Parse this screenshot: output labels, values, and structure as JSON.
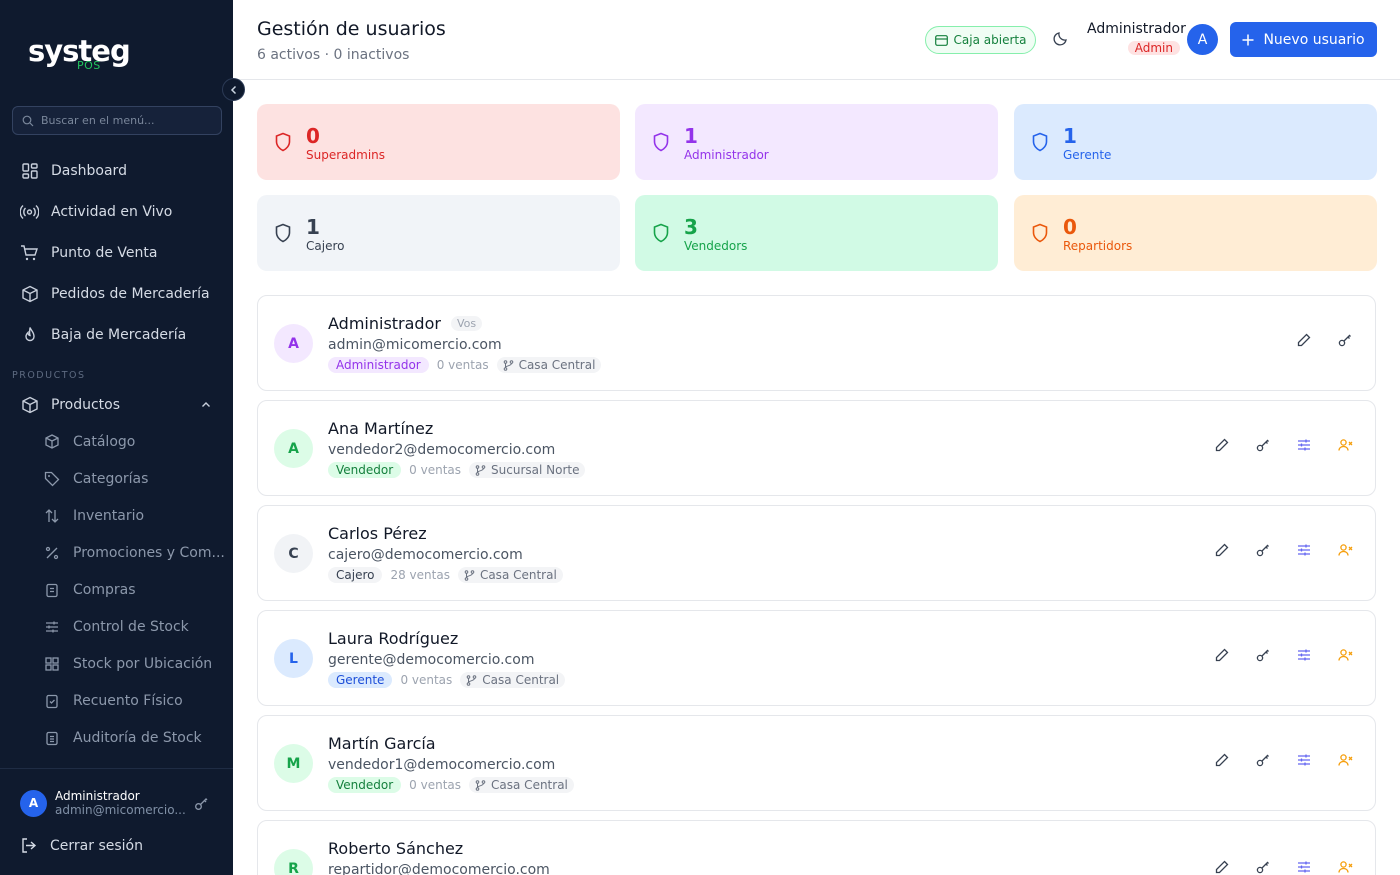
{
  "sidebar": {
    "logo": "systeg",
    "logo_sub": "POS",
    "search_placeholder": "Buscar en el menú...",
    "items": [
      {
        "label": "Dashboard"
      },
      {
        "label": "Actividad en Vivo"
      },
      {
        "label": "Punto de Venta"
      },
      {
        "label": "Pedidos de Mercadería"
      },
      {
        "label": "Baja de Mercadería"
      }
    ],
    "section_label": "PRODUCTOS",
    "group_label": "Productos",
    "subitems": [
      {
        "label": "Catálogo"
      },
      {
        "label": "Categorías"
      },
      {
        "label": "Inventario"
      },
      {
        "label": "Promociones y Com..."
      },
      {
        "label": "Compras"
      },
      {
        "label": "Control de Stock"
      },
      {
        "label": "Stock por Ubicación"
      },
      {
        "label": "Recuento Físico"
      },
      {
        "label": "Auditoría de Stock"
      }
    ],
    "user": {
      "initial": "A",
      "name": "Administrador",
      "email": "admin@micomercio..."
    },
    "logout_label": "Cerrar sesión"
  },
  "header": {
    "title": "Gestión de usuarios",
    "subtitle": "6 activos · 0 inactivos",
    "caja_label": "Caja abierta",
    "user_name": "Administrador",
    "user_role": "Admin",
    "user_initial": "A",
    "new_user_label": "Nuevo usuario"
  },
  "stats": [
    {
      "value": "0",
      "label": "Superadmins",
      "color": "#dc2626",
      "bg": "#fde2e1"
    },
    {
      "value": "1",
      "label": "Administrador",
      "color": "#9333ea",
      "bg": "#f3e8ff"
    },
    {
      "value": "1",
      "label": "Gerente",
      "color": "#2563eb",
      "bg": "#dbeafe"
    },
    {
      "value": "1",
      "label": "Cajero",
      "color": "#374151",
      "bg": "#f1f4f8"
    },
    {
      "value": "3",
      "label": "Vendedors",
      "color": "#16a34a",
      "bg": "#d1fae5"
    },
    {
      "value": "0",
      "label": "Repartidors",
      "color": "#ea580c",
      "bg": "#ffedd5"
    }
  ],
  "users": [
    {
      "initial": "A",
      "name": "Administrador",
      "you": "Vos",
      "email": "admin@micomercio.com",
      "role": "Administrador",
      "sales": "0 ventas",
      "branch": "Casa Central",
      "av_bg": "#f3e8ff",
      "av_fg": "#9333ea",
      "role_bg": "#f3e8ff",
      "role_fg": "#9333ea"
    },
    {
      "initial": "A",
      "name": "Ana Martínez",
      "email": "vendedor2@democomercio.com",
      "role": "Vendedor",
      "sales": "0 ventas",
      "branch": "Sucursal Norte",
      "av_bg": "#dcfce7",
      "av_fg": "#16a34a",
      "role_bg": "#dcfce7",
      "role_fg": "#15803d"
    },
    {
      "initial": "C",
      "name": "Carlos Pérez",
      "email": "cajero@democomercio.com",
      "role": "Cajero",
      "sales": "28 ventas",
      "branch": "Casa Central",
      "av_bg": "#f1f3f6",
      "av_fg": "#374151",
      "role_bg": "#f3f4f6",
      "role_fg": "#374151"
    },
    {
      "initial": "L",
      "name": "Laura Rodríguez",
      "email": "gerente@democomercio.com",
      "role": "Gerente",
      "sales": "0 ventas",
      "branch": "Casa Central",
      "av_bg": "#dbeafe",
      "av_fg": "#2563eb",
      "role_bg": "#dbeafe",
      "role_fg": "#1d4ed8"
    },
    {
      "initial": "M",
      "name": "Martín García",
      "email": "vendedor1@democomercio.com",
      "role": "Vendedor",
      "sales": "0 ventas",
      "branch": "Casa Central",
      "av_bg": "#dcfce7",
      "av_fg": "#16a34a",
      "role_bg": "#dcfce7",
      "role_fg": "#15803d"
    },
    {
      "initial": "R",
      "name": "Roberto Sánchez",
      "email": "repartidor@democomercio.com",
      "role": "",
      "sales": "",
      "branch": "",
      "av_bg": "#dcfce7",
      "av_fg": "#16a34a",
      "role_bg": "#dcfce7",
      "role_fg": "#15803d"
    }
  ]
}
